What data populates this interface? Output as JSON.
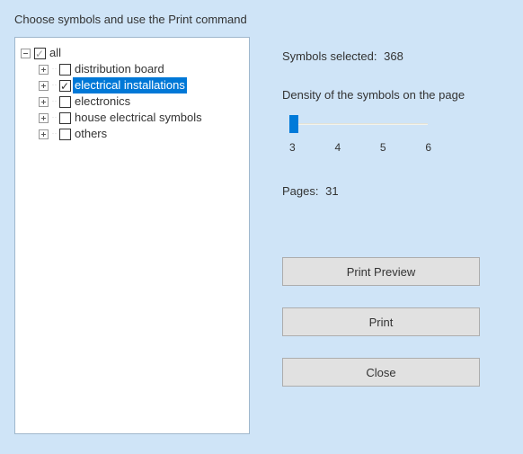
{
  "instruction": "Choose symbols and use the Print command",
  "tree": {
    "root": {
      "label": "all",
      "checked": "indet",
      "expanded": true
    },
    "children": [
      {
        "label": "distribution board",
        "checked": false
      },
      {
        "label": "electrical installations",
        "checked": true,
        "selected": true
      },
      {
        "label": "electronics",
        "checked": false
      },
      {
        "label": "house electrical symbols",
        "checked": false
      },
      {
        "label": "others",
        "checked": false
      }
    ]
  },
  "right": {
    "symbols_label": "Symbols selected:",
    "symbols_value": "368",
    "density_label": "Density of the symbols on the page",
    "slider": {
      "min": 3,
      "max": 6,
      "value": 3,
      "ticks": [
        "3",
        "4",
        "5",
        "6"
      ]
    },
    "pages_label": "Pages:",
    "pages_value": "31"
  },
  "buttons": {
    "preview": "Print Preview",
    "print": "Print",
    "close": "Close"
  }
}
